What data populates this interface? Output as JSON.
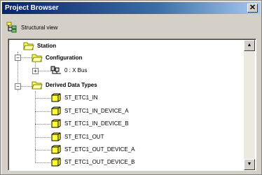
{
  "window": {
    "title": "Project Browser",
    "close_glyph": "✕"
  },
  "toolbar": {
    "view_label": "Structural view",
    "icon": "tree-structure-icon"
  },
  "tree": {
    "root": {
      "label": "Station",
      "icon": "folder-open-icon"
    },
    "configuration": {
      "label": "Configuration",
      "expander": "−",
      "icon": "folder-open-icon"
    },
    "bus": {
      "label": "0 : X Bus",
      "expander": "+",
      "icon": "bus-icon"
    },
    "derived": {
      "label": "Derived Data Types",
      "expander": "−",
      "icon": "folder-open-icon"
    },
    "types": [
      {
        "label": "ST_ETC1_IN"
      },
      {
        "label": "ST_ETC1_IN_DEVICE_A"
      },
      {
        "label": "ST_ETC1_IN_DEVICE_B"
      },
      {
        "label": "ST_ETC1_OUT"
      },
      {
        "label": "ST_ETC1_OUT_DEVICE_A"
      },
      {
        "label": "ST_ETC1_OUT_DEVICE_B"
      }
    ]
  },
  "scrollbar": {
    "up_glyph": "▲",
    "down_glyph": "▼"
  },
  "colors": {
    "folder_fill": "#ffff66",
    "folder_edge": "#808000",
    "titlebar": "#0a246a"
  }
}
